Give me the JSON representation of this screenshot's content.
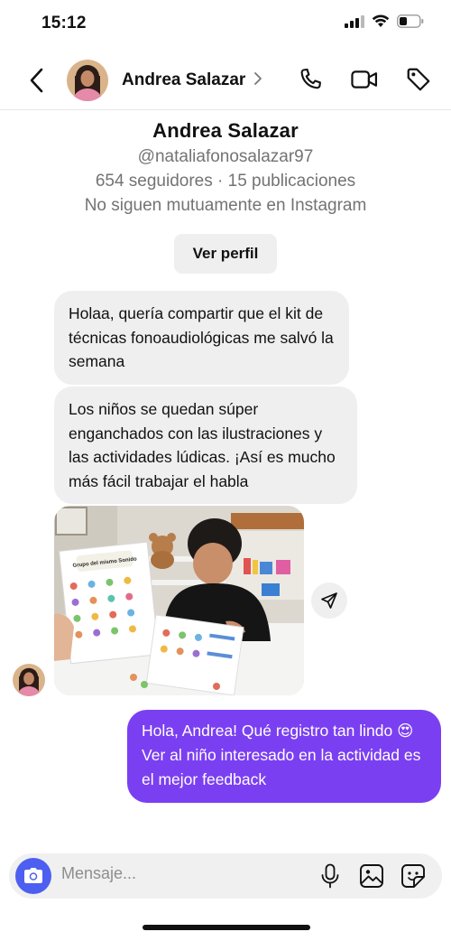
{
  "status_bar": {
    "time": "15:12",
    "icons": [
      "signal-icon",
      "wifi-icon",
      "battery-icon"
    ]
  },
  "header": {
    "contact_name": "Andrea Salazar",
    "icons": [
      "back-icon",
      "chevron-right-icon",
      "phone-icon",
      "video-icon",
      "tag-icon"
    ]
  },
  "profile": {
    "name": "Andrea Salazar",
    "username": "@nataliafonosalazar97",
    "stats": "654 seguidores · 15 publicaciones",
    "mutual": "No siguen mutuamente en Instagram",
    "view_profile_label": "Ver perfil"
  },
  "messages": [
    {
      "from": "contact",
      "text": "Holaa, quería compartir que el kit de técnicas fonoaudiológicas me salvó la semana"
    },
    {
      "from": "contact",
      "text": "Los niños se quedan súper enganchados con las ilustraciones y las actividades lúdicas. ¡Así es mucho más fácil trabajar el habla"
    },
    {
      "from": "contact",
      "type": "photo",
      "worksheet_title": "Grupo del mismo Sonido"
    },
    {
      "from": "me",
      "text": "Hola, Andrea! Qué registro tan lindo 😍 Ver al niño interesado en la actividad es el mejor feedback"
    }
  ],
  "composer": {
    "placeholder": "Mensaje...",
    "icons": [
      "camera-icon",
      "microphone-icon",
      "gallery-icon",
      "sticker-icon"
    ]
  },
  "colors": {
    "outgoing_bubble": "#7b3ff2",
    "incoming_bubble": "#efefef",
    "camera_button": "#4d5ff0"
  }
}
